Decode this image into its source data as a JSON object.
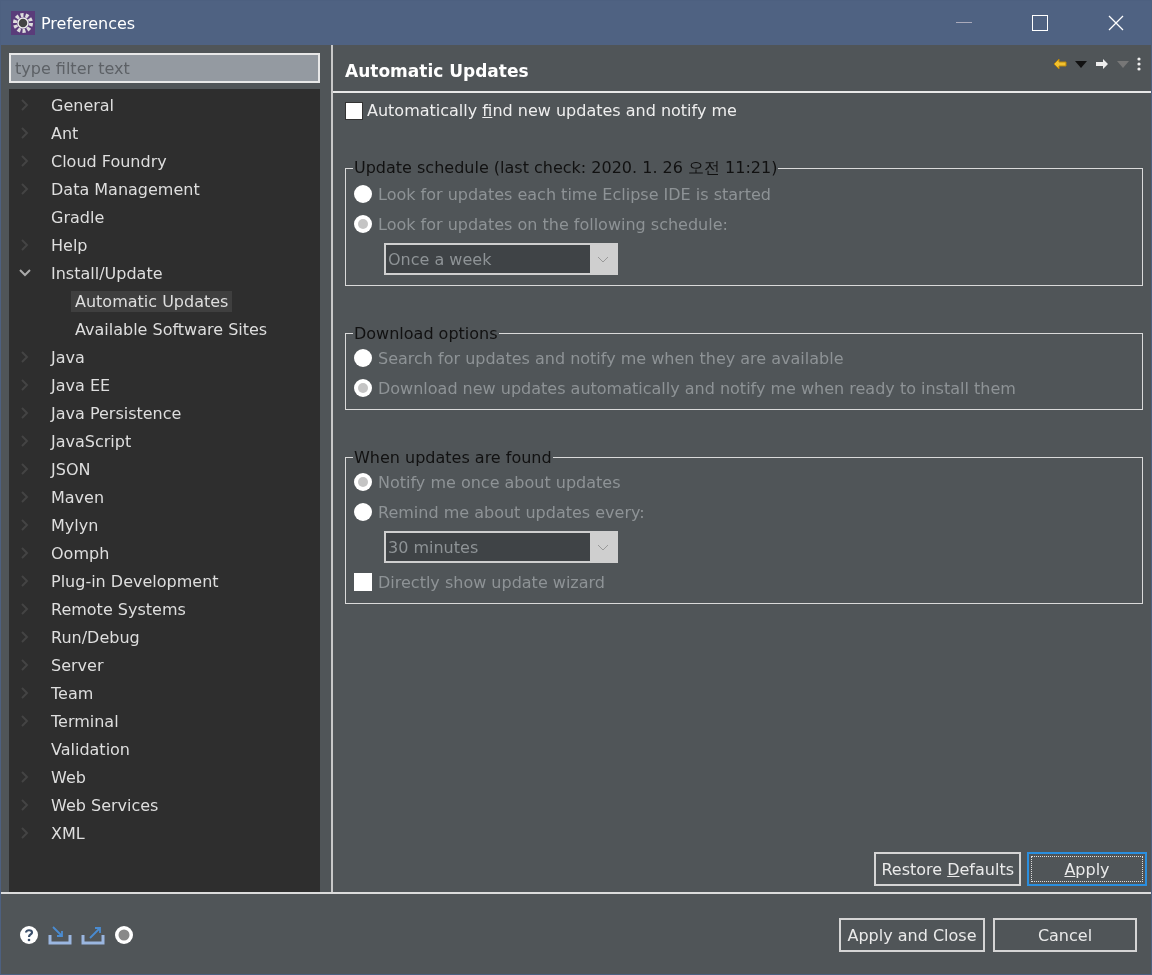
{
  "window": {
    "title": "Preferences"
  },
  "filter": {
    "placeholder": "type filter text"
  },
  "tree": [
    {
      "label": "General",
      "expanded": false,
      "selected": false
    },
    {
      "label": "Ant",
      "expanded": false,
      "selected": false
    },
    {
      "label": "Cloud Foundry",
      "expanded": false,
      "selected": false
    },
    {
      "label": "Data Management",
      "expanded": false,
      "selected": false
    },
    {
      "label": "Gradle",
      "selected": false
    },
    {
      "label": "Help",
      "expanded": false,
      "selected": false
    },
    {
      "label": "Install/Update",
      "expanded": true,
      "selected": false,
      "children": [
        {
          "label": "Automatic Updates",
          "selected": true
        },
        {
          "label": "Available Software Sites",
          "selected": false
        }
      ]
    },
    {
      "label": "Java",
      "expanded": false,
      "selected": false
    },
    {
      "label": "Java EE",
      "expanded": false,
      "selected": false
    },
    {
      "label": "Java Persistence",
      "expanded": false,
      "selected": false
    },
    {
      "label": "JavaScript",
      "expanded": false,
      "selected": false
    },
    {
      "label": "JSON",
      "expanded": false,
      "selected": false
    },
    {
      "label": "Maven",
      "expanded": false,
      "selected": false
    },
    {
      "label": "Mylyn",
      "expanded": false,
      "selected": false
    },
    {
      "label": "Oomph",
      "expanded": false,
      "selected": false
    },
    {
      "label": "Plug-in Development",
      "expanded": false,
      "selected": false
    },
    {
      "label": "Remote Systems",
      "expanded": false,
      "selected": false
    },
    {
      "label": "Run/Debug",
      "expanded": false,
      "selected": false
    },
    {
      "label": "Server",
      "expanded": false,
      "selected": false
    },
    {
      "label": "Team",
      "expanded": false,
      "selected": false
    },
    {
      "label": "Terminal",
      "expanded": false,
      "selected": false
    },
    {
      "label": "Validation",
      "selected": false
    },
    {
      "label": "Web",
      "expanded": false,
      "selected": false
    },
    {
      "label": "Web Services",
      "expanded": false,
      "selected": false
    },
    {
      "label": "XML",
      "expanded": false,
      "selected": false
    }
  ],
  "page": {
    "title": "Automatic Updates",
    "auto_check": {
      "label_pre": "Automatically ",
      "label_key": "f",
      "label_post": "ind new updates and notify me",
      "checked": false
    },
    "groups": [
      {
        "title": "Update schedule (last check: 2020. 1. 26 오전 11:21)",
        "disabled": true,
        "items": [
          {
            "kind": "radio",
            "label": "Look for updates each time Eclipse IDE is started",
            "selected": false
          },
          {
            "kind": "radio",
            "label": "Look for updates on the following schedule:",
            "selected": true
          },
          {
            "kind": "select",
            "value": "Once a week"
          }
        ]
      },
      {
        "title": "Download options",
        "disabled": true,
        "items": [
          {
            "kind": "radio",
            "label": "Search for updates and notify me when they are available",
            "selected": false
          },
          {
            "kind": "radio",
            "label": "Download new updates automatically and notify me when ready to install them",
            "selected": true
          }
        ]
      },
      {
        "title": "When updates are found",
        "disabled": true,
        "items": [
          {
            "kind": "radio",
            "label": "Notify me once about updates",
            "selected": true
          },
          {
            "kind": "radio",
            "label": "Remind me about updates every:",
            "selected": false
          },
          {
            "kind": "select",
            "value": "30 minutes"
          },
          {
            "kind": "checkbox",
            "label": "Directly show update wizard",
            "checked": false
          }
        ]
      }
    ],
    "buttons": [
      {
        "label_pre": "Restore ",
        "label_key": "D",
        "label_post": "efaults",
        "focused": false
      },
      {
        "label_key": "A",
        "label_post": "pply",
        "focused": true
      }
    ]
  },
  "footer_buttons": [
    "Apply and Close",
    "Cancel"
  ]
}
